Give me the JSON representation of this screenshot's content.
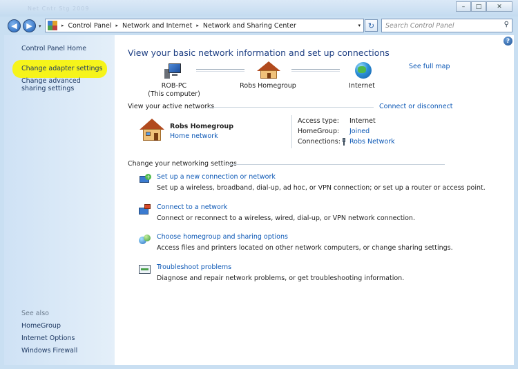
{
  "window": {
    "title_ghost": "Net  Cntr  Stg  2009",
    "minimize_glyph": "–",
    "maximize_glyph": "□",
    "close_glyph": "✕"
  },
  "address": {
    "breadcrumbs": [
      "Control Panel",
      "Network and Internet",
      "Network and Sharing Center"
    ],
    "separator": "▸",
    "dropdown_glyph": "▾",
    "search_placeholder": "Search Control Panel"
  },
  "nav": {
    "back_glyph": "◀",
    "forward_glyph": "▶",
    "refresh_glyph": "↻",
    "search_glyph": "⚲",
    "help_glyph": "?"
  },
  "sidebar": {
    "items": [
      {
        "label": "Control Panel Home"
      },
      {
        "label": "Change adapter settings"
      },
      {
        "label": "Change advanced sharing settings"
      }
    ],
    "see_also_title": "See also",
    "see_also": [
      {
        "label": "HomeGroup"
      },
      {
        "label": "Internet Options"
      },
      {
        "label": "Windows Firewall"
      }
    ]
  },
  "main": {
    "heading": "View your basic network information and set up connections",
    "see_full_map": "See full map",
    "map": {
      "computer_name": "ROB-PC",
      "computer_sub": "(This computer)",
      "homegroup": "Robs Homegroup",
      "internet": "Internet"
    },
    "active_networks_title": "View your active networks",
    "connect_disconnect": "Connect or disconnect",
    "network": {
      "name": "Robs Homegroup",
      "type": "Home network",
      "access_type_label": "Access type:",
      "access_type_value": "Internet",
      "homegroup_label": "HomeGroup:",
      "homegroup_value": "Joined",
      "connections_label": "Connections:",
      "connections_value": "Robs Network"
    },
    "settings_title": "Change your networking settings",
    "tasks": [
      {
        "title": "Set up a new connection or network",
        "desc": "Set up a wireless, broadband, dial-up, ad hoc, or VPN connection; or set up a router or access point."
      },
      {
        "title": "Connect to a network",
        "desc": "Connect or reconnect to a wireless, wired, dial-up, or VPN network connection."
      },
      {
        "title": "Choose homegroup and sharing options",
        "desc": "Access files and printers located on other network computers, or change sharing settings."
      },
      {
        "title": "Troubleshoot problems",
        "desc": "Diagnose and repair network problems, or get troubleshooting information."
      }
    ]
  },
  "colors": {
    "link": "#0b57b5",
    "heading": "#1e3f83",
    "highlight": "#f6f41b",
    "sidebar_bg": "#d6e7f7"
  }
}
